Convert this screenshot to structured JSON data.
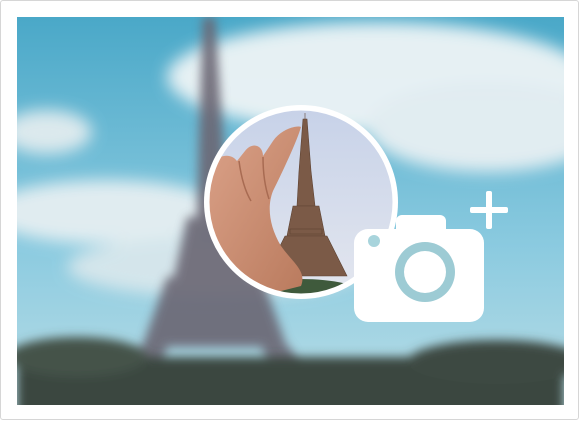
{
  "colors": {
    "sky_top": "#5fb3cf",
    "sky_bottom": "#a9d7e3",
    "cloud": "#f2f6f7",
    "tower": "#6b6570",
    "ground": "#2f3a36",
    "circle_border": "#ffffff",
    "inner_sky_top": "#c9d4e9",
    "inner_sky_bottom": "#e3e7f0",
    "inner_tower": "#7a5a48",
    "hand": "#c98f72",
    "camera_body": "#ffffff",
    "camera_lens_ring": "#8fc7d0",
    "add_icon": "#ffffff"
  },
  "icons": {
    "camera": "camera-icon",
    "plus": "plus-icon"
  }
}
